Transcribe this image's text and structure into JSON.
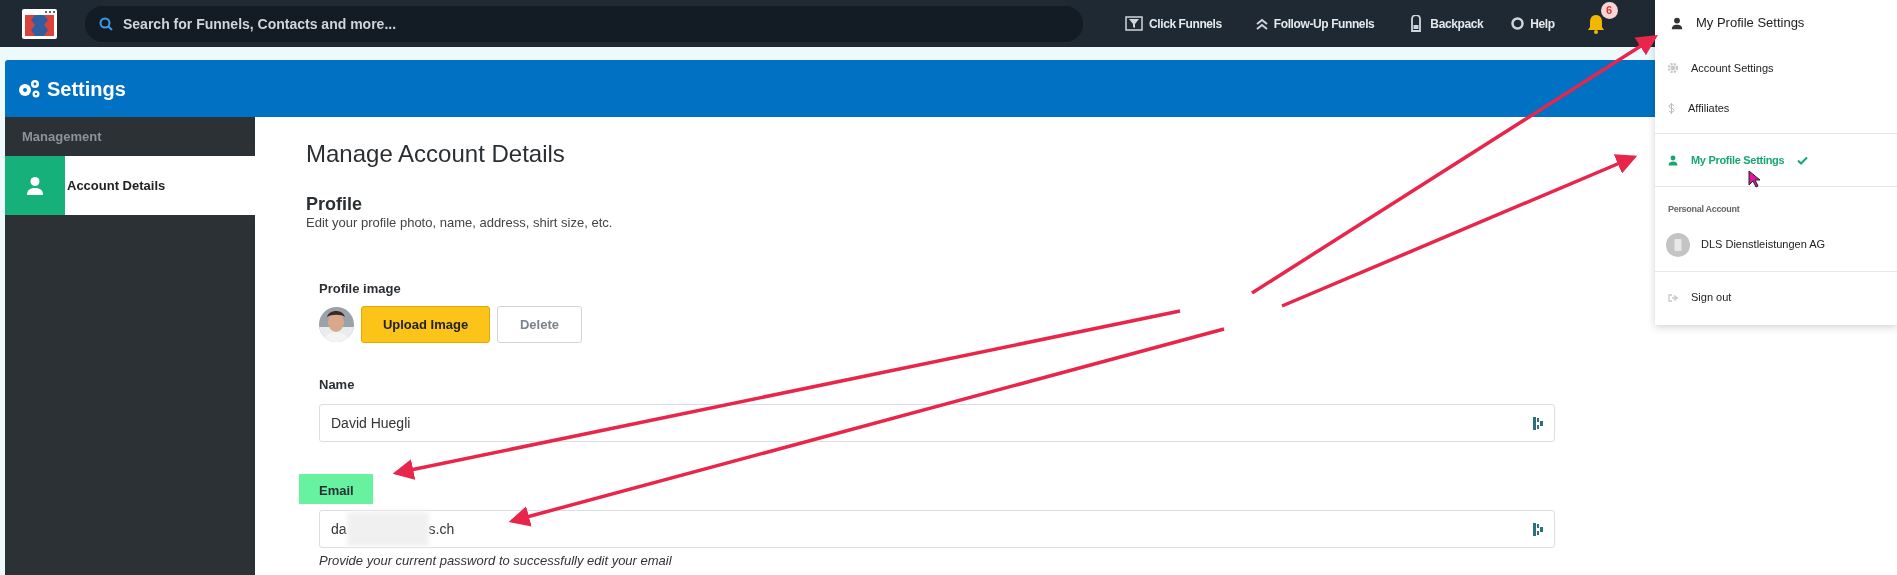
{
  "topbar": {
    "search": {
      "placeholder": "Search for Funnels, Contacts and more..."
    },
    "nav": [
      {
        "label": "Click Funnels"
      },
      {
        "label": "Follow-Up Funnels"
      },
      {
        "label": "Backpack"
      },
      {
        "label": "Help"
      }
    ],
    "notifications": {
      "count": "6"
    }
  },
  "header": {
    "title": "Settings"
  },
  "sidebar": {
    "section": "Management",
    "items": [
      {
        "label": "Account Details",
        "selected": true
      }
    ]
  },
  "content": {
    "title": "Manage Account Details",
    "section_title": "Profile",
    "section_subtitle": "Edit your profile photo, name, address, shirt size, etc.",
    "profile_image": {
      "label": "Profile image",
      "buttons": [
        {
          "label": "Upload Image",
          "kind": "primary"
        },
        {
          "label": "Delete",
          "kind": "secondary"
        }
      ]
    },
    "fields": [
      {
        "label": "Name",
        "value": "David Huegli",
        "highlighted": false
      },
      {
        "label": "Email",
        "value_start": "da",
        "value_end": "s.ch",
        "redacted": true,
        "highlighted": true,
        "hint": "Provide your current password to successfully edit your email"
      }
    ]
  },
  "dropdown": {
    "title": "My Profile Settings",
    "sections": [
      {
        "items": [
          {
            "label": "Account Settings",
            "selected": false
          },
          {
            "label": "Affiliates",
            "selected": false
          }
        ]
      },
      {
        "items": [
          {
            "label": "My Profile Settings",
            "selected": true
          }
        ]
      },
      {
        "heading": "Personal Account",
        "items": [
          {
            "label": "DLS Dienstleistungen AG",
            "kind": "account"
          }
        ]
      },
      {
        "items": [
          {
            "label": "Sign out",
            "kind": "signout"
          }
        ]
      }
    ]
  }
}
